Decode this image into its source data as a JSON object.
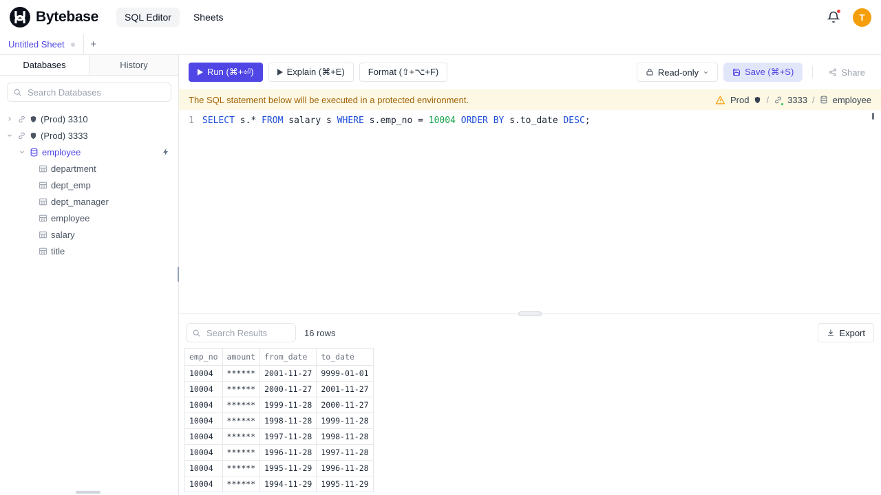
{
  "header": {
    "brand": "Bytebase",
    "nav": [
      {
        "label": "SQL Editor",
        "active": true
      },
      {
        "label": "Sheets",
        "active": false
      }
    ],
    "avatar_letter": "T"
  },
  "sheet_tabs": {
    "title": "Untitled Sheet",
    "add_label": "+"
  },
  "sidebar": {
    "tabs": [
      {
        "label": "Databases",
        "active": true
      },
      {
        "label": "History",
        "active": false
      }
    ],
    "search_placeholder": "Search Databases",
    "instances": [
      {
        "label": "(Prod) 3310",
        "expanded": false
      },
      {
        "label": "(Prod) 3333",
        "expanded": true
      }
    ],
    "database_label": "employee",
    "tables": [
      "department",
      "dept_emp",
      "dept_manager",
      "employee",
      "salary",
      "title"
    ]
  },
  "toolbar": {
    "run_label": "Run (⌘+⏎)",
    "explain_label": "Explain (⌘+E)",
    "format_label": "Format (⇧+⌥+F)",
    "readonly_label": "Read-only",
    "save_label": "Save (⌘+S)",
    "share_label": "Share"
  },
  "banner": {
    "message": "The SQL statement below will be executed in a protected environment.",
    "environment": "Prod",
    "separator": "/",
    "instance": "3333",
    "database": "employee"
  },
  "editor": {
    "line_number": "1",
    "tokens": [
      {
        "t": "SELECT",
        "c": "kw"
      },
      {
        "t": " s.",
        "c": "pl"
      },
      {
        "t": "*",
        "c": "pl"
      },
      {
        "t": " ",
        "c": "pl"
      },
      {
        "t": "FROM",
        "c": "kw"
      },
      {
        "t": " salary s ",
        "c": "pl"
      },
      {
        "t": "WHERE",
        "c": "kw"
      },
      {
        "t": " s.emp_no ",
        "c": "pl"
      },
      {
        "t": "= ",
        "c": "pl"
      },
      {
        "t": "10004",
        "c": "num"
      },
      {
        "t": " ",
        "c": "pl"
      },
      {
        "t": "ORDER BY",
        "c": "kw"
      },
      {
        "t": " s.to_date ",
        "c": "pl"
      },
      {
        "t": "DESC",
        "c": "kw"
      },
      {
        "t": ";",
        "c": "pl"
      }
    ]
  },
  "results": {
    "search_placeholder": "Search Results",
    "row_count": "16 rows",
    "export_label": "Export",
    "columns": [
      "emp_no",
      "amount",
      "from_date",
      "to_date"
    ],
    "rows": [
      [
        "10004",
        "******",
        "2001-11-27",
        "9999-01-01"
      ],
      [
        "10004",
        "******",
        "2000-11-27",
        "2001-11-27"
      ],
      [
        "10004",
        "******",
        "1999-11-28",
        "2000-11-27"
      ],
      [
        "10004",
        "******",
        "1998-11-28",
        "1999-11-28"
      ],
      [
        "10004",
        "******",
        "1997-11-28",
        "1998-11-28"
      ],
      [
        "10004",
        "******",
        "1996-11-28",
        "1997-11-28"
      ],
      [
        "10004",
        "******",
        "1995-11-29",
        "1996-11-28"
      ],
      [
        "10004",
        "******",
        "1994-11-29",
        "1995-11-29"
      ]
    ]
  },
  "colors": {
    "accent": "#4f46e5",
    "keyword": "#1d4ed8",
    "number": "#16a34a",
    "warning_text": "#a16207",
    "warning_bg": "#fcf8e3",
    "avatar_bg": "#f59e0b",
    "notification_dot": "#ef4444"
  }
}
